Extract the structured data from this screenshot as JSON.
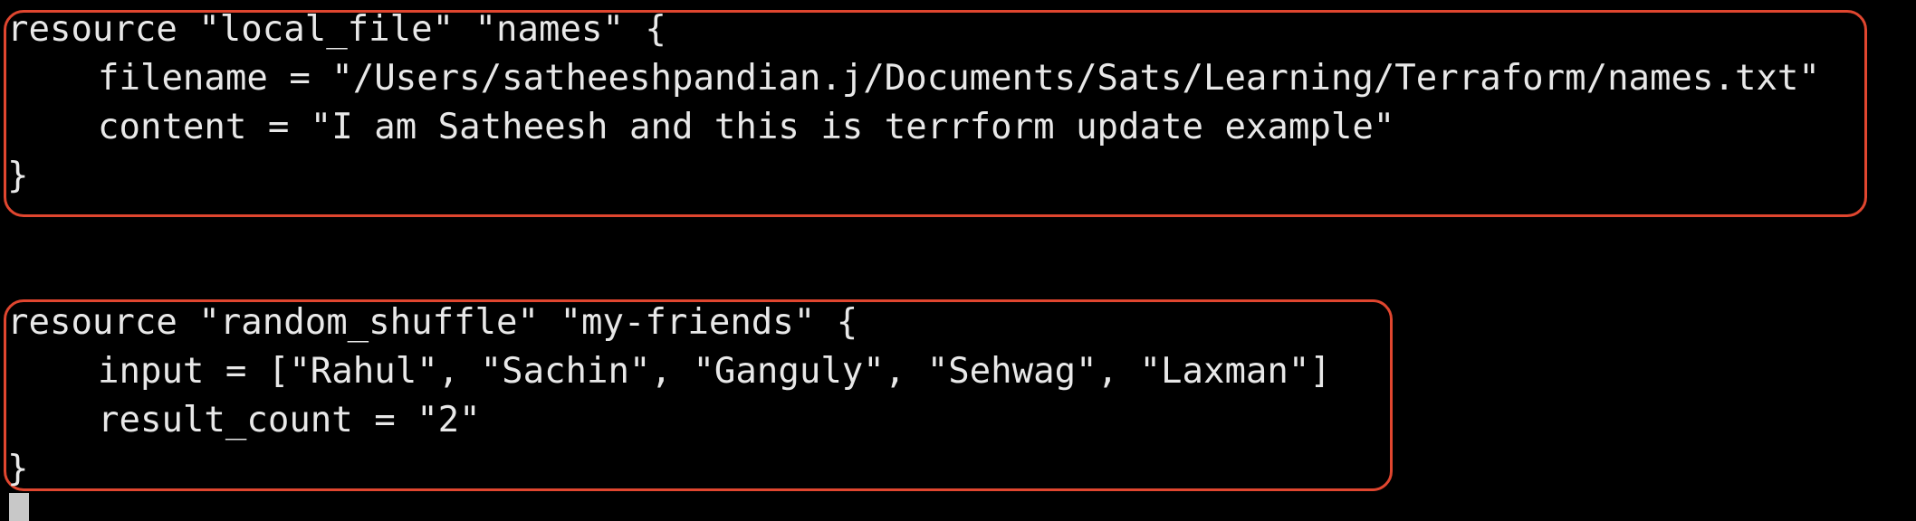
{
  "terminal": {
    "block_1": {
      "line_1": "resource \"local_file\" \"names\" {",
      "line_2": "filename = \"/Users/satheeshpandian.j/Documents/Sats/Learning/Terraform/names.txt\"",
      "line_3": "content = \"I am Satheesh and this is terrform update example\"",
      "line_4": "}"
    },
    "block_2": {
      "line_1": "resource \"random_shuffle\" \"my-friends\" {",
      "line_2": "input = [\"Rahul\", \"Sachin\", \"Ganguly\", \"Sehwag\", \"Laxman\"]",
      "line_3": "result_count = \"2\"",
      "line_4": "}"
    },
    "highlight_color": "#e0462f",
    "text_color": "#e8e8e8",
    "background_color": "#000000"
  }
}
